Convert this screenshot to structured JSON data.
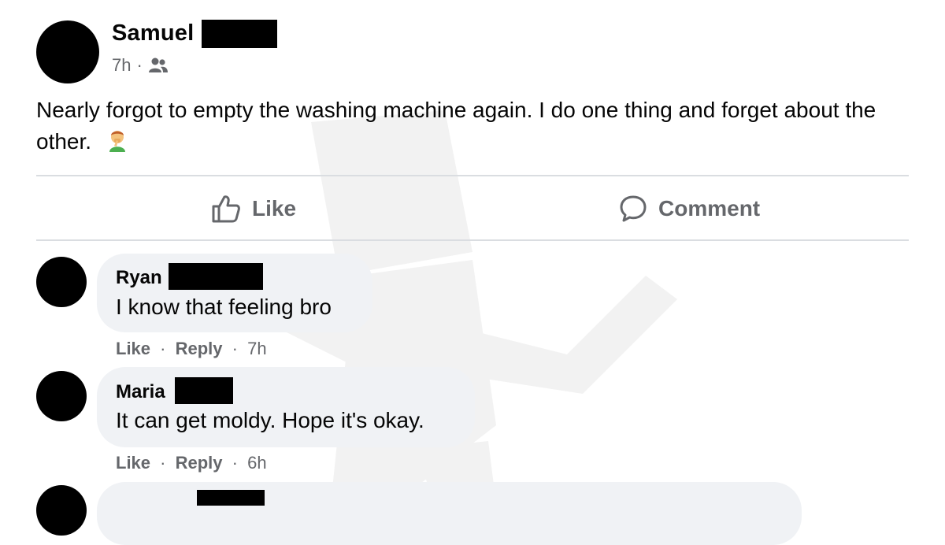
{
  "post": {
    "author": "Samuel",
    "time": "7h",
    "separator": "·",
    "audience_icon": "friends-icon",
    "text": "Nearly forgot to empty the washing machine again. I do one thing and forget about the other.",
    "emoji": "person-facepalming-emoji"
  },
  "actions": {
    "like_label": "Like",
    "comment_label": "Comment"
  },
  "comments": [
    {
      "name": "Ryan",
      "text": "I know that feeling bro",
      "like": "Like",
      "reply": "Reply",
      "sep": "·",
      "time": "7h"
    },
    {
      "name": "Maria",
      "text": "It can get moldy. Hope it's okay.",
      "like": "Like",
      "reply": "Reply",
      "sep": "·",
      "time": "6h"
    }
  ],
  "colors": {
    "divider": "#dadde1",
    "secondary_text": "#65676b",
    "bubble": "#f0f2f5"
  }
}
